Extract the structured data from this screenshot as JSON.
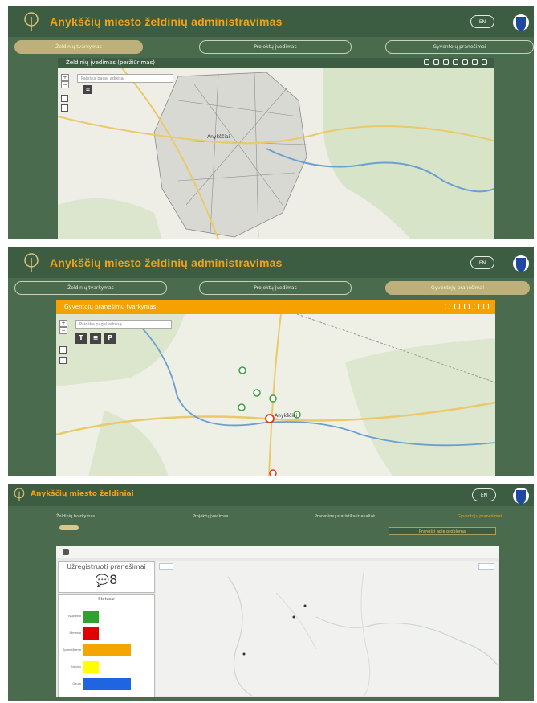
{
  "header": {
    "app_title": "Anykščių miesto želdinių administravimas",
    "app_title_short": "Anykščių miesto želdiniai",
    "lang": "EN"
  },
  "panel1": {
    "tabs": [
      "Želdinių tvarkymas",
      "Projektų įvedimas",
      "Gyventojų pranešimai"
    ],
    "active_tab": 0,
    "map_title": "Želdinių įvedimas (peržiūrimas)",
    "search_placeholder": "Paieška pagal adresą",
    "place_label": "Anykščiai"
  },
  "panel2": {
    "tabs": [
      "Želdinių tvarkymas",
      "Projektų įvedimas",
      "Gyventojų pranešimai"
    ],
    "active_tab": 2,
    "map_title": "Gyventojų pranešimų tvarkymas",
    "search_placeholder": "Paieška pagal adresą",
    "tool_buttons": [
      "T",
      "≡",
      "P"
    ],
    "place_label": "Anykščiai"
  },
  "panel3": {
    "top_links": [
      "Želdinių tvarkymas",
      "Projektų įvedimas",
      "Pranešimų statistika ir analizė",
      "Gyventojų pranešimai"
    ],
    "sub_button": "Pranešti apie problemą",
    "count_title": "Užregistruoti pranešimai",
    "count_value": "8",
    "stats_title": "Statusai",
    "bars": [
      {
        "label": "Išspręsta",
        "value": 1,
        "color": "#2fa12f"
      },
      {
        "label": "Atmesta",
        "value": 1,
        "color": "#e00000"
      },
      {
        "label": "Sprendžiama",
        "value": 3,
        "color": "#f5a500"
      },
      {
        "label": "Naujas",
        "value": 1,
        "color": "#ffff00"
      },
      {
        "label": "Gauta",
        "value": 3,
        "color": "#1f64e0"
      }
    ]
  },
  "colors": {
    "header_bg": "#3d5d42",
    "panel_bg": "#4a6b4e",
    "title_orange": "#f0a31a",
    "active_tab": "#bdb07a",
    "accent_orange": "#f5a200"
  }
}
